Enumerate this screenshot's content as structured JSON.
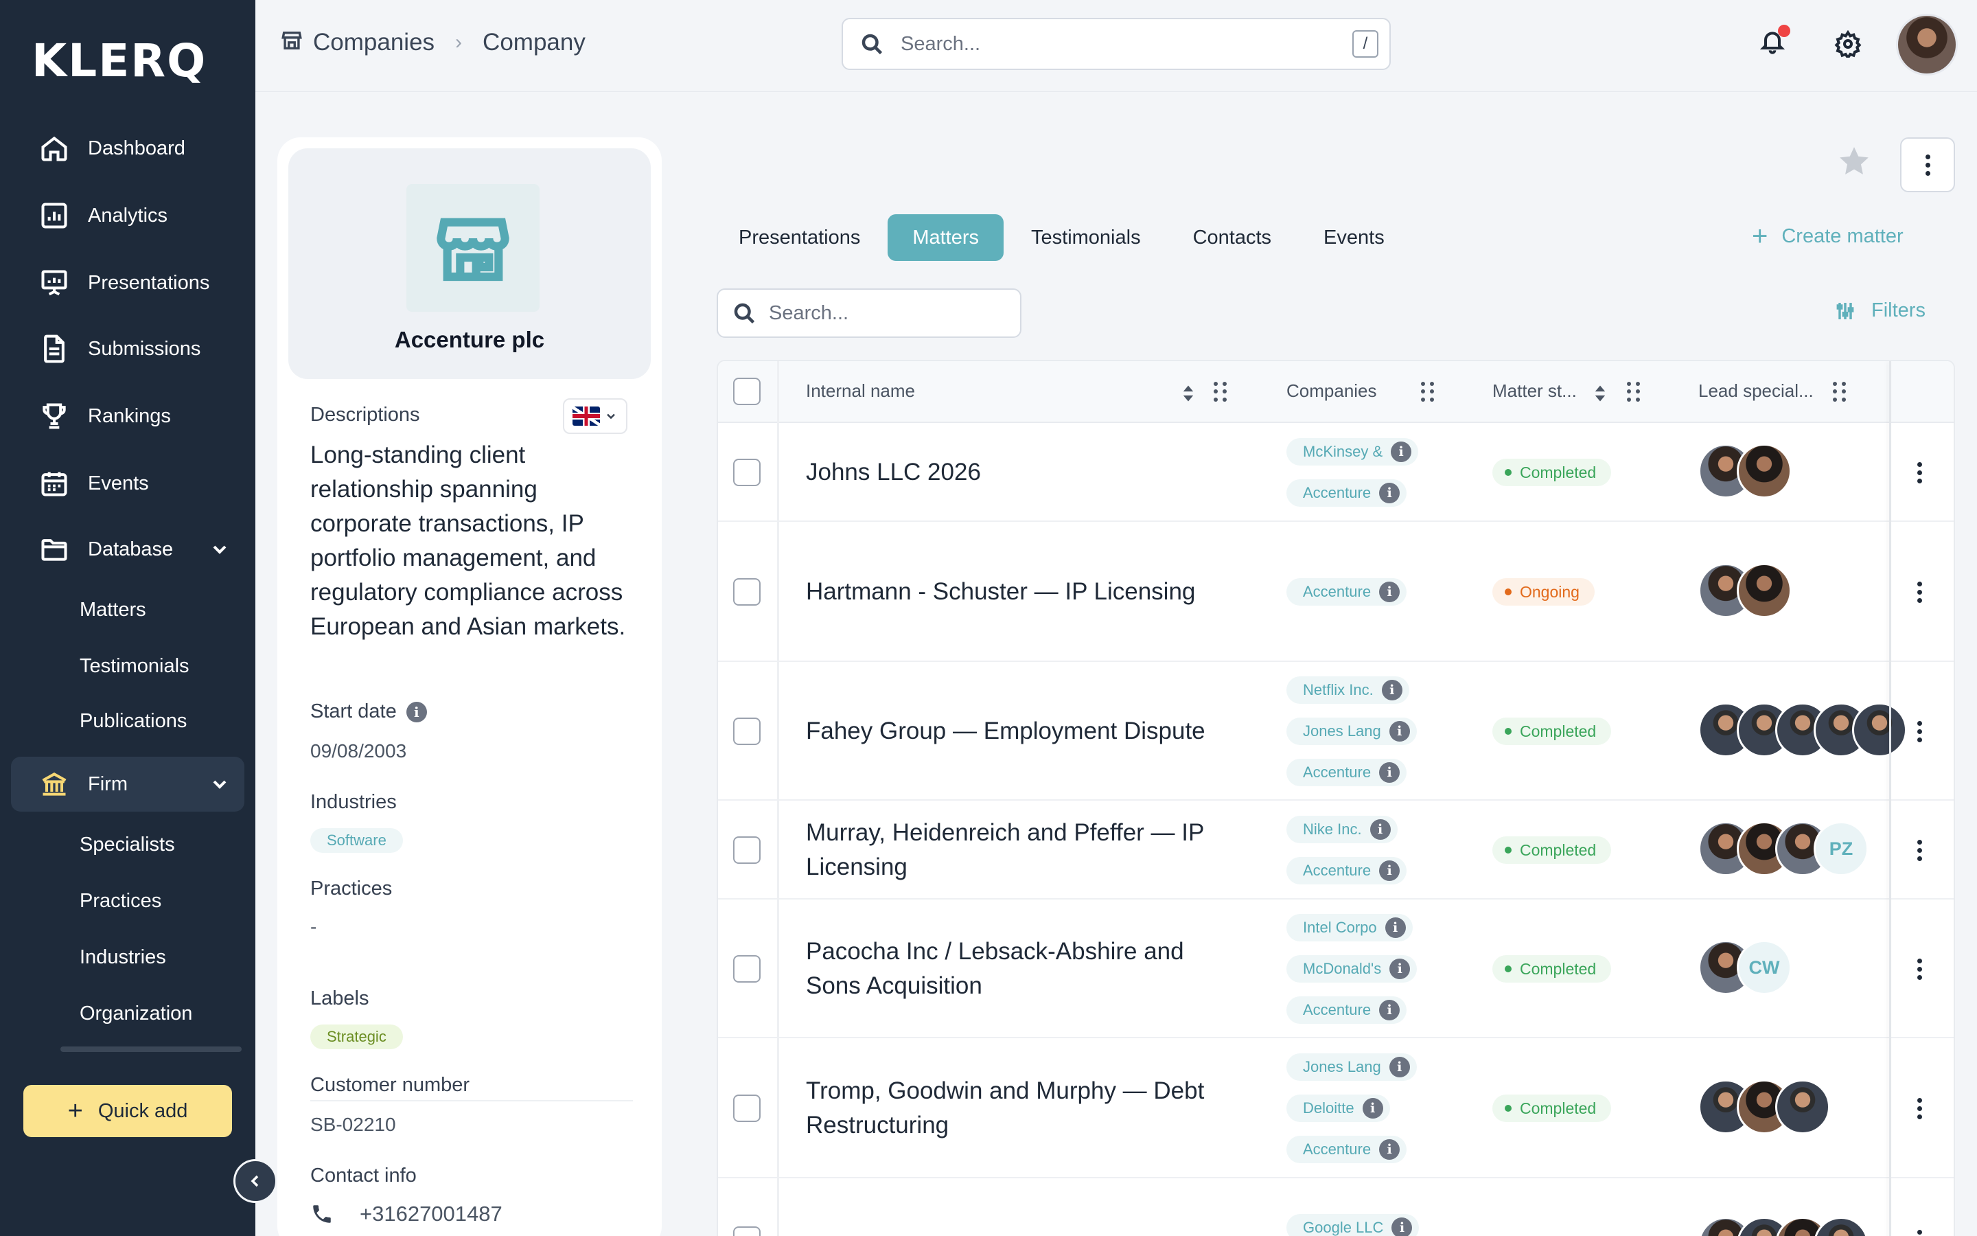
{
  "sidebar": {
    "logo": "KLERQ",
    "nav": [
      {
        "label": "Dashboard",
        "icon": "home-icon"
      },
      {
        "label": "Analytics",
        "icon": "chart-icon"
      },
      {
        "label": "Presentations",
        "icon": "presentation-icon"
      },
      {
        "label": "Submissions",
        "icon": "document-icon"
      },
      {
        "label": "Rankings",
        "icon": "trophy-icon"
      },
      {
        "label": "Events",
        "icon": "calendar-icon"
      },
      {
        "label": "Database",
        "icon": "folder-icon"
      }
    ],
    "database_sub": [
      "Matters",
      "Testimonials",
      "Publications"
    ],
    "firm": {
      "label": "Firm",
      "icon": "bank-icon",
      "active": true
    },
    "firm_sub": [
      "Specialists",
      "Practices",
      "Industries",
      "Organization"
    ],
    "quick_add": "Quick add"
  },
  "topbar": {
    "breadcrumb": [
      "Companies",
      "Company"
    ],
    "search_placeholder": "Search...",
    "search_shortcut": "/",
    "has_notification": true
  },
  "company": {
    "name": "Accenture plc",
    "descriptions_label": "Descriptions",
    "description": "Long-standing client relationship spanning corporate transactions, IP portfolio management, and regulatory compliance across European and Asian markets.",
    "start_date_label": "Start date",
    "start_date": "09/08/2003",
    "industries_label": "Industries",
    "industries": [
      "Software"
    ],
    "practices_label": "Practices",
    "practices": "-",
    "labels_label": "Labels",
    "labels": [
      "Strategic"
    ],
    "customer_number_label": "Customer number",
    "customer_number": "SB-02210",
    "contact_info_label": "Contact info",
    "phone": "+31627001487"
  },
  "tabs": [
    "Presentations",
    "Matters",
    "Testimonials",
    "Contacts",
    "Events"
  ],
  "active_tab": "Matters",
  "create_matter": "Create matter",
  "table_search_placeholder": "Search...",
  "filters": "Filters",
  "table": {
    "columns": [
      "Internal name",
      "Companies",
      "Matter st...",
      "Lead special..."
    ],
    "rows": [
      {
        "name": "Johns LLC 2026",
        "companies": [
          "McKinsey &",
          "Accenture"
        ],
        "status": "Completed",
        "status_type": "done",
        "avatars": [
          "f",
          "f2"
        ]
      },
      {
        "name": "Hartmann - Schuster — IP Licensing",
        "companies": [
          "Accenture"
        ],
        "status": "Ongoing",
        "status_type": "ongoing",
        "avatars": [
          "f",
          "f2"
        ]
      },
      {
        "name": "Fahey Group — Employment Dispute",
        "companies": [
          "Netflix Inc.",
          "Jones Lang",
          "Accenture"
        ],
        "status": "Completed",
        "status_type": "done",
        "avatars": [
          "m",
          "m",
          "m",
          "m",
          "m"
        ]
      },
      {
        "name": "Murray, Heidenreich and Pfeffer — IP Licensing",
        "companies": [
          "Nike Inc.",
          "Accenture"
        ],
        "status": "Completed",
        "status_type": "done",
        "avatars": [
          "f",
          "f2",
          "f",
          "PZ"
        ]
      },
      {
        "name": "Pacocha Inc / Lebsack-Abshire and Sons Acquisition",
        "companies": [
          "Intel Corpo",
          "McDonald's",
          "Accenture"
        ],
        "status": "Completed",
        "status_type": "done",
        "avatars": [
          "f",
          "CW"
        ]
      },
      {
        "name": "Tromp, Goodwin and Murphy — Debt Restructuring",
        "companies": [
          "Jones Lang",
          "Deloitte",
          "Accenture"
        ],
        "status": "Completed",
        "status_type": "done",
        "avatars": [
          "m",
          "f2",
          "m"
        ]
      },
      {
        "name": "",
        "companies": [
          "Google LLC"
        ],
        "status": "",
        "status_type": "ongoing",
        "avatars": [
          "f",
          "m",
          "f2",
          "m"
        ]
      }
    ]
  }
}
